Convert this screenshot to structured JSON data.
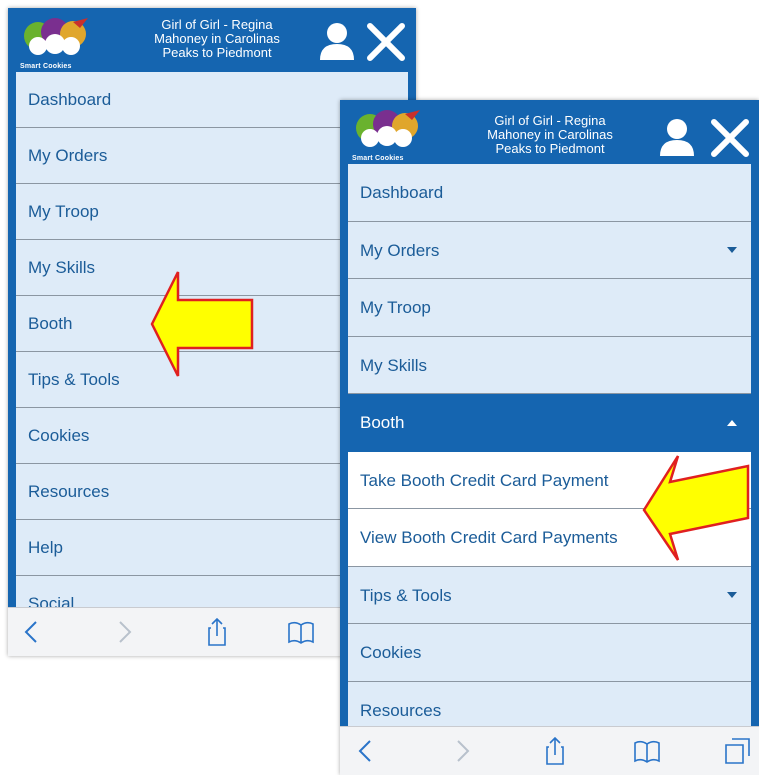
{
  "left_screen": {
    "logo_text": "Smart Cookies",
    "header_title": "Girl of Girl - Regina Mahoney in Carolinas Peaks to Piedmont",
    "menu": [
      "Dashboard",
      "My Orders",
      "My Troop",
      "My Skills",
      "Booth",
      "Tips & Tools",
      "Cookies",
      "Resources",
      "Help",
      "Social"
    ]
  },
  "right_screen": {
    "logo_text": "Smart Cookies",
    "header_title": "Girl of Girl - Regina Mahoney in Carolinas Peaks to Piedmont",
    "menu": [
      {
        "label": "Dashboard"
      },
      {
        "label": "My Orders",
        "chevron": "down"
      },
      {
        "label": "My Troop"
      },
      {
        "label": "My Skills"
      },
      {
        "label": "Booth",
        "chevron": "up",
        "active": true
      },
      {
        "label": "Take Booth Credit Card Payment",
        "sub": true
      },
      {
        "label": "View Booth Credit Card Payments",
        "sub": true
      },
      {
        "label": "Tips & Tools",
        "chevron": "down"
      },
      {
        "label": "Cookies"
      },
      {
        "label": "Resources"
      }
    ]
  },
  "icons": [
    "user-icon",
    "close-icon",
    "back-icon",
    "forward-icon",
    "share-icon",
    "bookmarks-icon",
    "tabs-icon"
  ],
  "colors": {
    "header_blue": "#1565b0",
    "menu_bg": "#deebf8",
    "menu_text": "#1b5c98",
    "arrow_fill": "#ffff00",
    "arrow_stroke": "#e02020"
  }
}
